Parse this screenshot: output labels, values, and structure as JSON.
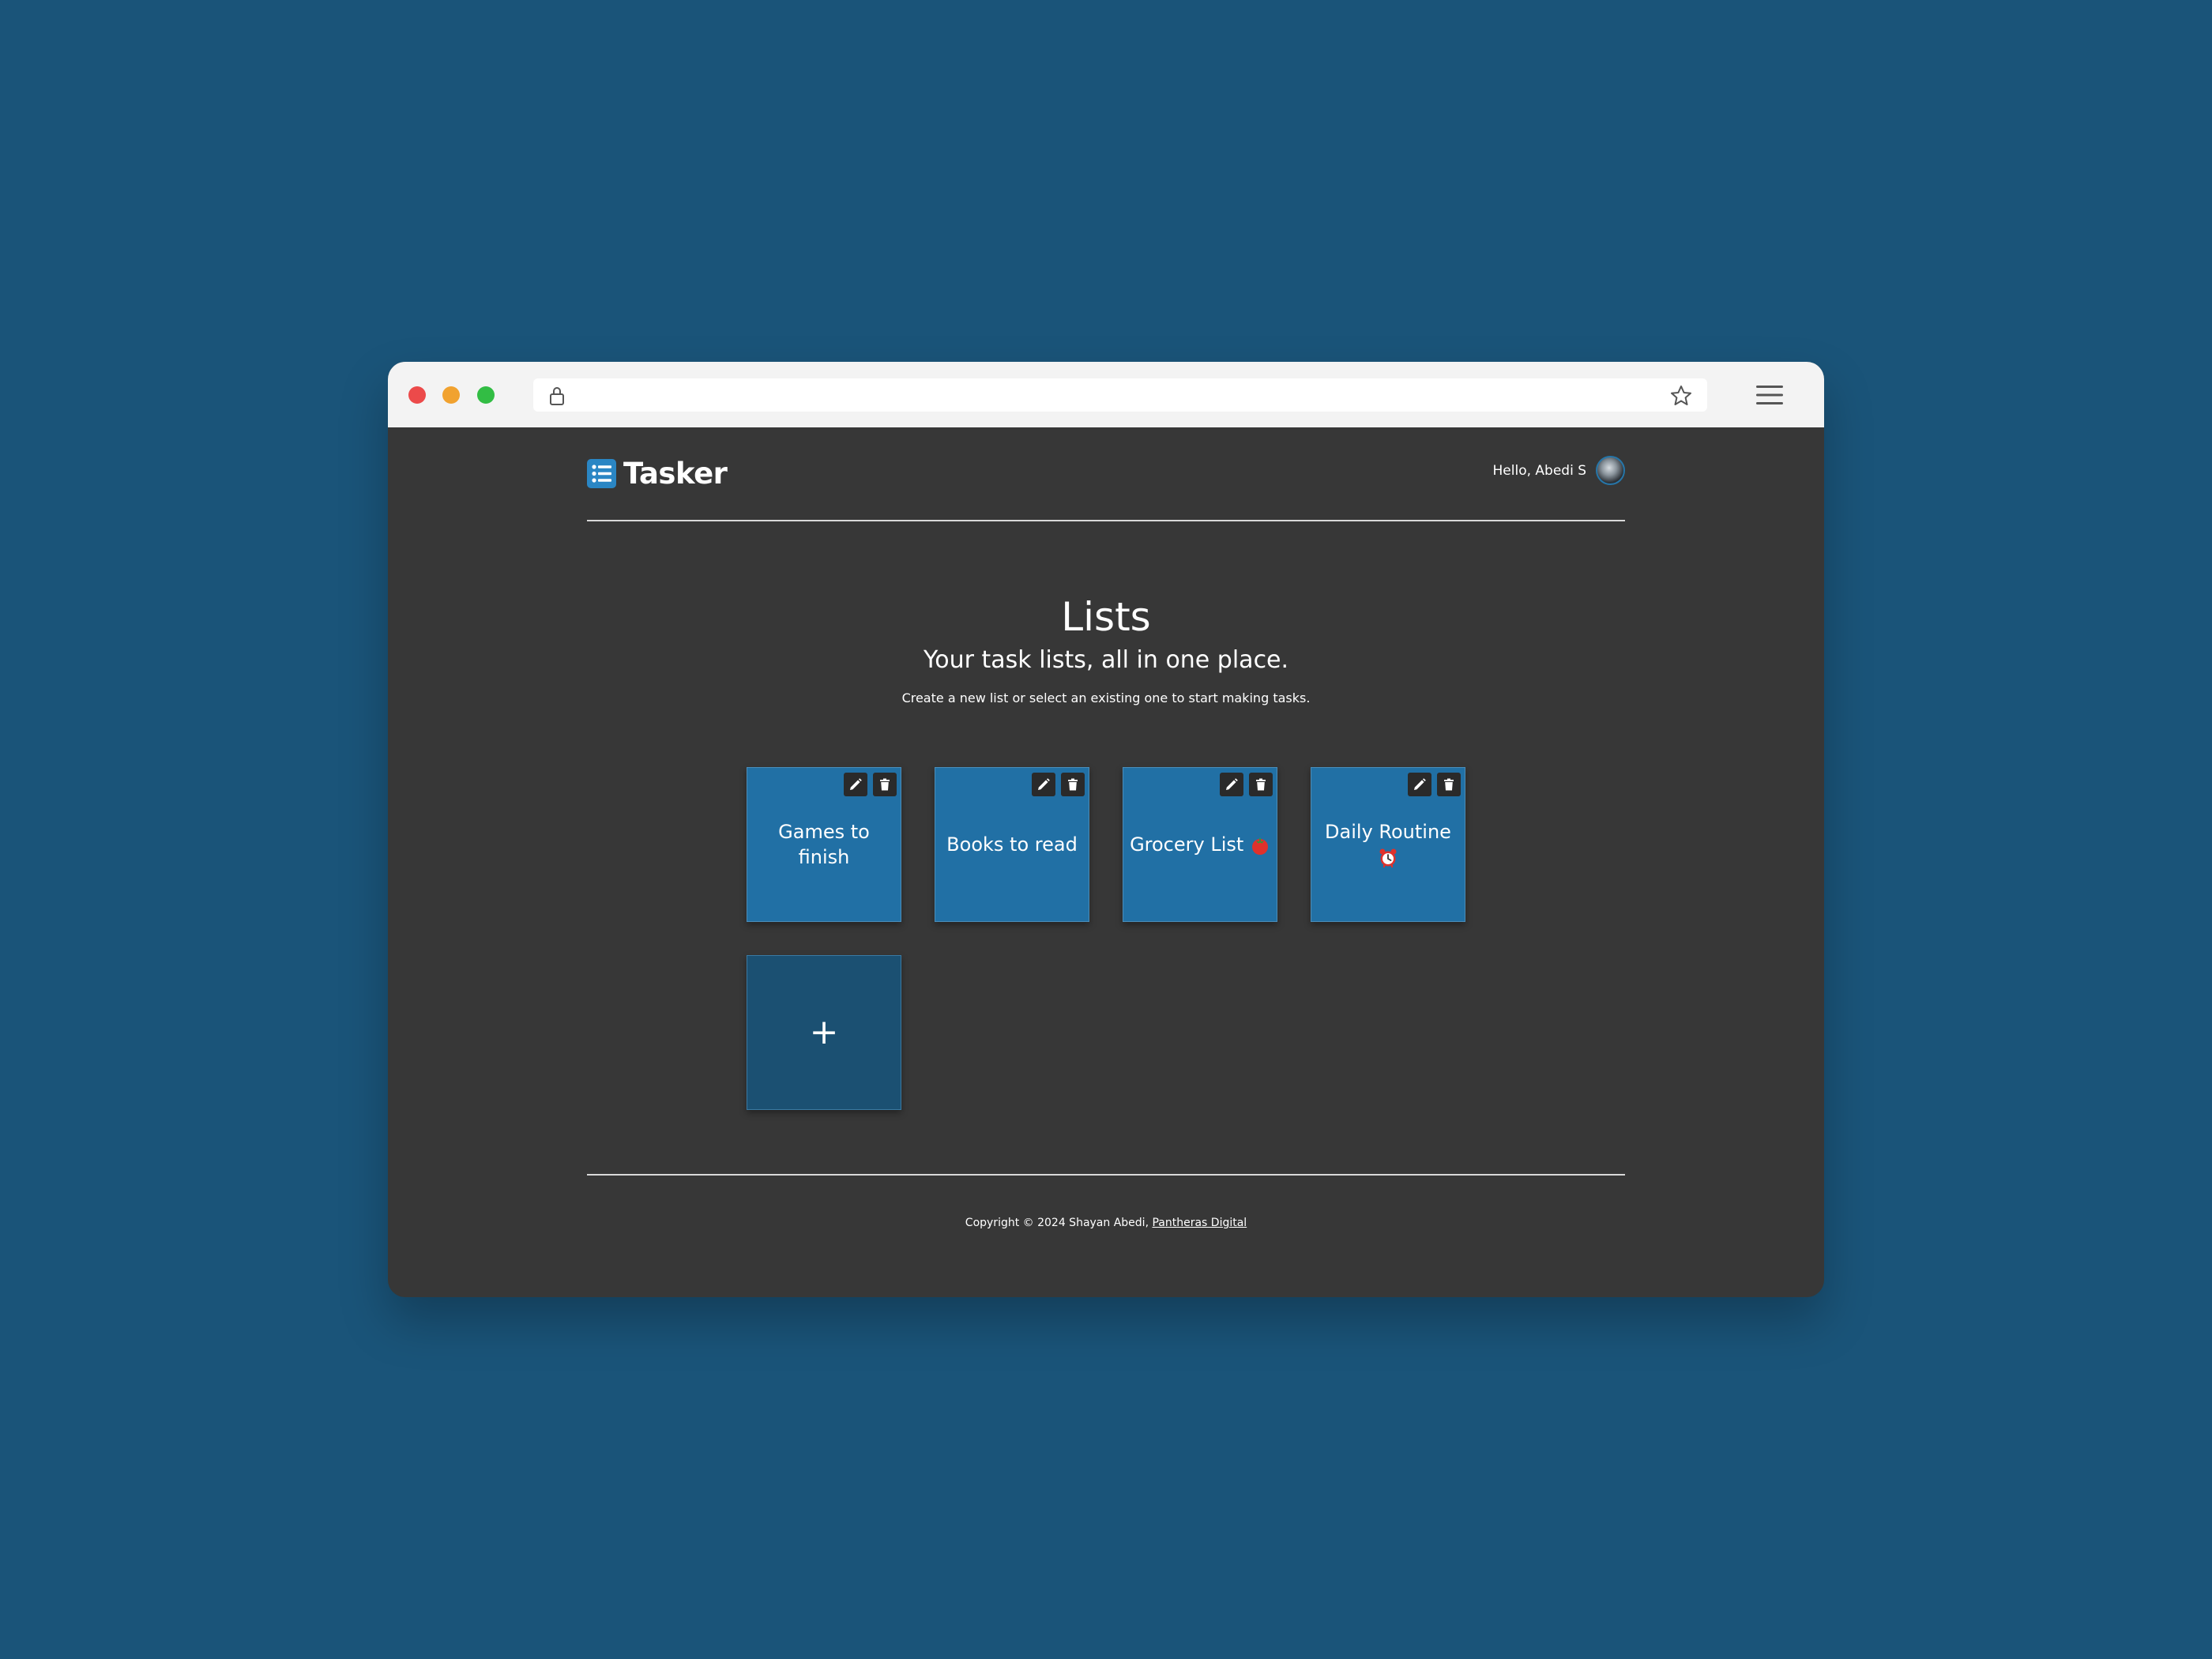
{
  "app": {
    "brand": "Tasker"
  },
  "header": {
    "greeting": "Hello, Abedi S"
  },
  "page": {
    "title": "Lists",
    "subtitle": "Your task lists, all in one place.",
    "helper": "Create a new list or select an existing one to start making tasks."
  },
  "lists": [
    {
      "title": "Games to finish",
      "emoji": ""
    },
    {
      "title": "Books to read",
      "emoji": ""
    },
    {
      "title": "Grocery List",
      "emoji": "tomato"
    },
    {
      "title": "Daily Routine",
      "emoji": "alarm-clock"
    }
  ],
  "add_card": {
    "label": "+"
  },
  "footer": {
    "copyright": "Copyright © 2024 Shayan Abedi,",
    "link": "Pantheras Digital"
  },
  "icons": {
    "list": "list-icon",
    "edit": "pencil-icon",
    "delete": "trash-icon",
    "lock": "lock-icon",
    "bookmark": "star-icon",
    "menu": "hamburger-icon"
  },
  "colors": {
    "background": "#1a5479",
    "page": "#373737",
    "card": "#2170a5",
    "add_card": "#1b5072",
    "accent": "#2676a9"
  }
}
